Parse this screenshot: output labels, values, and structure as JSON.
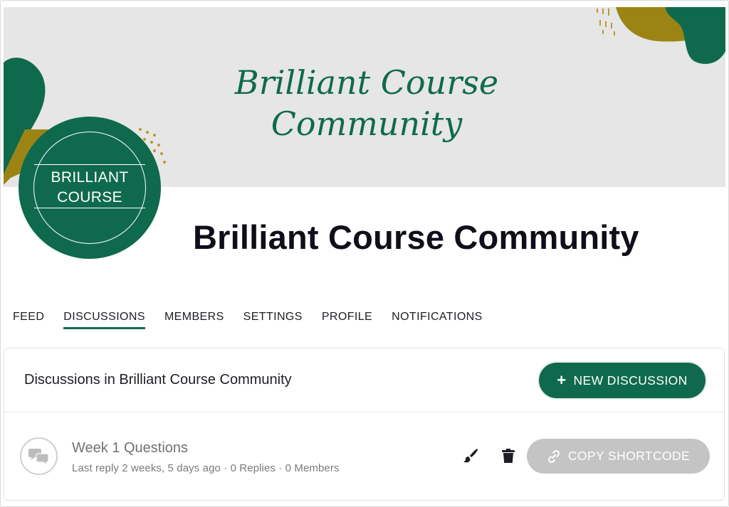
{
  "banner": {
    "script_line1": "Brilliant Course",
    "script_line2": "Community"
  },
  "avatar": {
    "line1": "BRILLIANT",
    "line2": "COURSE"
  },
  "group": {
    "title": "Brilliant Course Community"
  },
  "tabs": [
    {
      "label": "FEED",
      "active": false
    },
    {
      "label": "DISCUSSIONS",
      "active": true
    },
    {
      "label": "MEMBERS",
      "active": false
    },
    {
      "label": "SETTINGS",
      "active": false
    },
    {
      "label": "PROFILE",
      "active": false
    },
    {
      "label": "NOTIFICATIONS",
      "active": false
    }
  ],
  "discussions": {
    "heading": "Discussions in Brilliant Course Community",
    "new_button": "NEW DISCUSSION",
    "new_button_icon": "plus-icon",
    "items": [
      {
        "title": "Week 1 Questions",
        "meta": "Last reply 2 weeks, 5 days ago · 0 Replies · 0 Members",
        "icon": "chat-bubbles-icon",
        "copy_button": "COPY SHORTCODE"
      }
    ]
  },
  "colors": {
    "brand_green": "#0f6a4d",
    "mustard": "#9c8414",
    "banner_bg": "#e6e6e6",
    "disabled_button": "#c4c4c4"
  }
}
